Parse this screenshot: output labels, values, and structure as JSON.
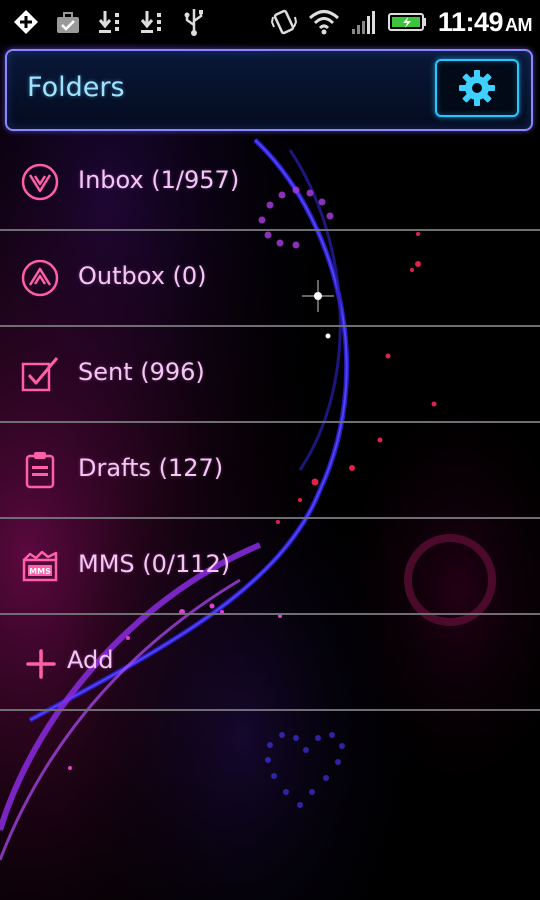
{
  "status_bar": {
    "time": "11:49",
    "ampm": "AM",
    "icons": [
      "usb-debug-icon",
      "briefcase-icon",
      "download-icon",
      "download-icon",
      "usb-icon",
      "vibrate-icon",
      "wifi-icon",
      "signal-icon",
      "battery-icon"
    ]
  },
  "header": {
    "title": "Folders",
    "settings_icon": "gear-icon"
  },
  "folders": [
    {
      "label": "Inbox (1/957)",
      "icon": "inbox-icon"
    },
    {
      "label": "Outbox (0)",
      "icon": "outbox-icon"
    },
    {
      "label": "Sent (996)",
      "icon": "sent-icon"
    },
    {
      "label": "Drafts (127)",
      "icon": "drafts-icon"
    },
    {
      "label": "MMS (0/112)",
      "icon": "mms-icon",
      "badge": "MMS"
    },
    {
      "label": "Add",
      "icon": "plus-icon"
    }
  ],
  "colors": {
    "accent_blue": "#27c7ff",
    "title_text": "#9fe3ff",
    "row_text": "#f2c8f2",
    "icon_pink": "#ff5fa8",
    "header_border": "#8a86ff",
    "divider": "#6e6e74"
  }
}
